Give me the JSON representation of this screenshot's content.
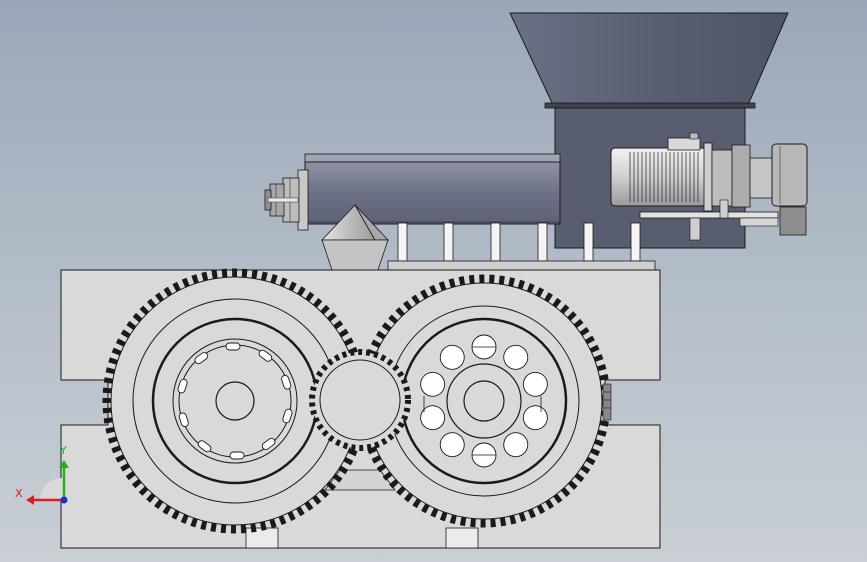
{
  "viewport": {
    "background_top": "#99a7b8",
    "background_bottom": "#c9cfd5"
  },
  "model": {
    "body_color": "#d9d9d9",
    "hopper_color": "#5a5f72",
    "motor_color": "#d6d6d6",
    "line_color": "#1a1a1a"
  },
  "triad": {
    "x_label": "X",
    "y_label": "Y",
    "x_color": "#d42020",
    "y_color": "#20b020",
    "z_color": "#2030c0"
  }
}
